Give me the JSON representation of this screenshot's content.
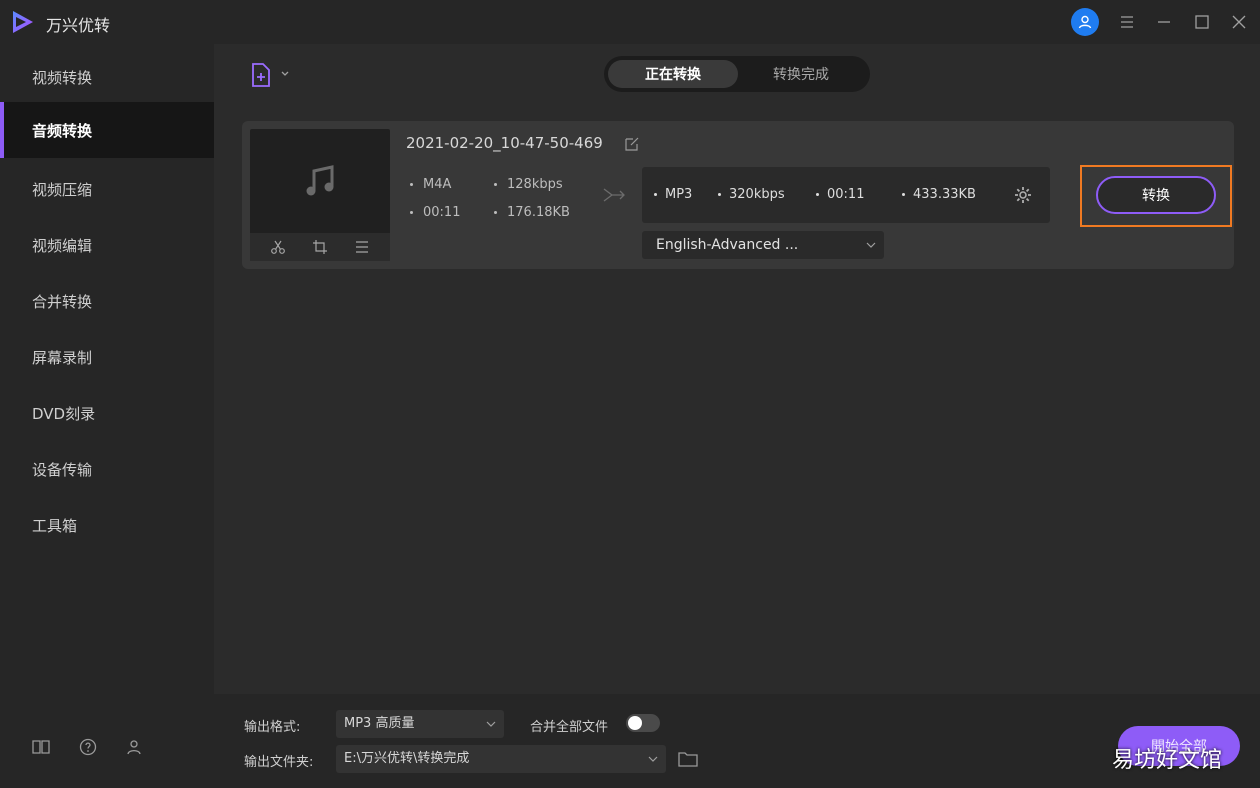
{
  "app": {
    "title": "万兴优转"
  },
  "sidebar": {
    "items": [
      {
        "label": "视频转换"
      },
      {
        "label": "音频转换",
        "active": true
      },
      {
        "label": "视频压缩"
      },
      {
        "label": "视频编辑"
      },
      {
        "label": "合并转换"
      },
      {
        "label": "屏幕录制"
      },
      {
        "label": "DVD刻录"
      },
      {
        "label": "设备传输"
      },
      {
        "label": "工具箱"
      }
    ]
  },
  "tabs": [
    {
      "label": "正在转换",
      "active": true
    },
    {
      "label": "转换完成"
    }
  ],
  "file": {
    "name": "2021-02-20_10-47-50-469",
    "source": {
      "format": "M4A",
      "bitrate": "128kbps",
      "duration": "00:11",
      "size": "176.18KB"
    },
    "target": {
      "format": "MP3",
      "bitrate": "320kbps",
      "duration": "00:11",
      "size": "433.33KB"
    },
    "audio_track": "English-Advanced ...",
    "convert_label": "转换"
  },
  "bottom": {
    "output_format_label": "输出格式:",
    "output_format_value": "MP3 高质量",
    "merge_label": "合并全部文件",
    "merge_on": false,
    "output_folder_label": "输出文件夹:",
    "output_folder_value": "E:\\万兴优转\\转换完成",
    "start_all_label": "開始全部"
  },
  "watermark": "易坊好文馆",
  "colors": {
    "accent": "#8e5cf7",
    "highlight": "#f07a22",
    "avatar": "#1f7cf0"
  }
}
